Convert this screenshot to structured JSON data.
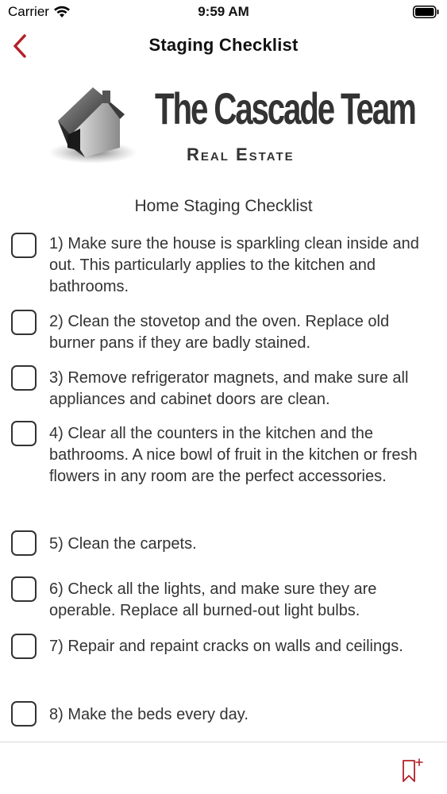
{
  "status_bar": {
    "carrier": "Carrier",
    "time": "9:59 AM"
  },
  "nav": {
    "title": "Staging Checklist",
    "back_icon": "chevron-left-icon"
  },
  "logo": {
    "title": "The Cascade Team",
    "subtitle": "Real Estate"
  },
  "heading": "Home Staging Checklist",
  "items": [
    {
      "text": "1) Make sure the house is sparkling clean inside and out. This particularly applies to the kitchen and bathrooms.",
      "checked": false
    },
    {
      "text": "2) Clean the stovetop and the oven. Replace old burner pans if they are badly stained.",
      "checked": false
    },
    {
      "text": "3) Remove refrigerator magnets, and make sure all appliances and cabinet doors are clean.",
      "checked": false
    },
    {
      "text": "4) Clear all the counters in the kitchen and the bathrooms. A nice bowl of fruit in the kitchen or fresh flowers in any room are the perfect accessories.",
      "checked": false
    },
    {
      "text": "5) Clean the carpets.",
      "checked": false
    },
    {
      "text": "6) Check all the lights, and make sure they are operable. Replace all burned-out light bulbs.",
      "checked": false
    },
    {
      "text": "7) Repair and repaint cracks on walls and ceilings.",
      "checked": false
    },
    {
      "text": "8) Make the beds every day.",
      "checked": false
    }
  ],
  "colors": {
    "accent": "#b3202a",
    "text": "#333333"
  },
  "toolbar": {
    "bookmark_icon": "bookmark-add-icon"
  }
}
